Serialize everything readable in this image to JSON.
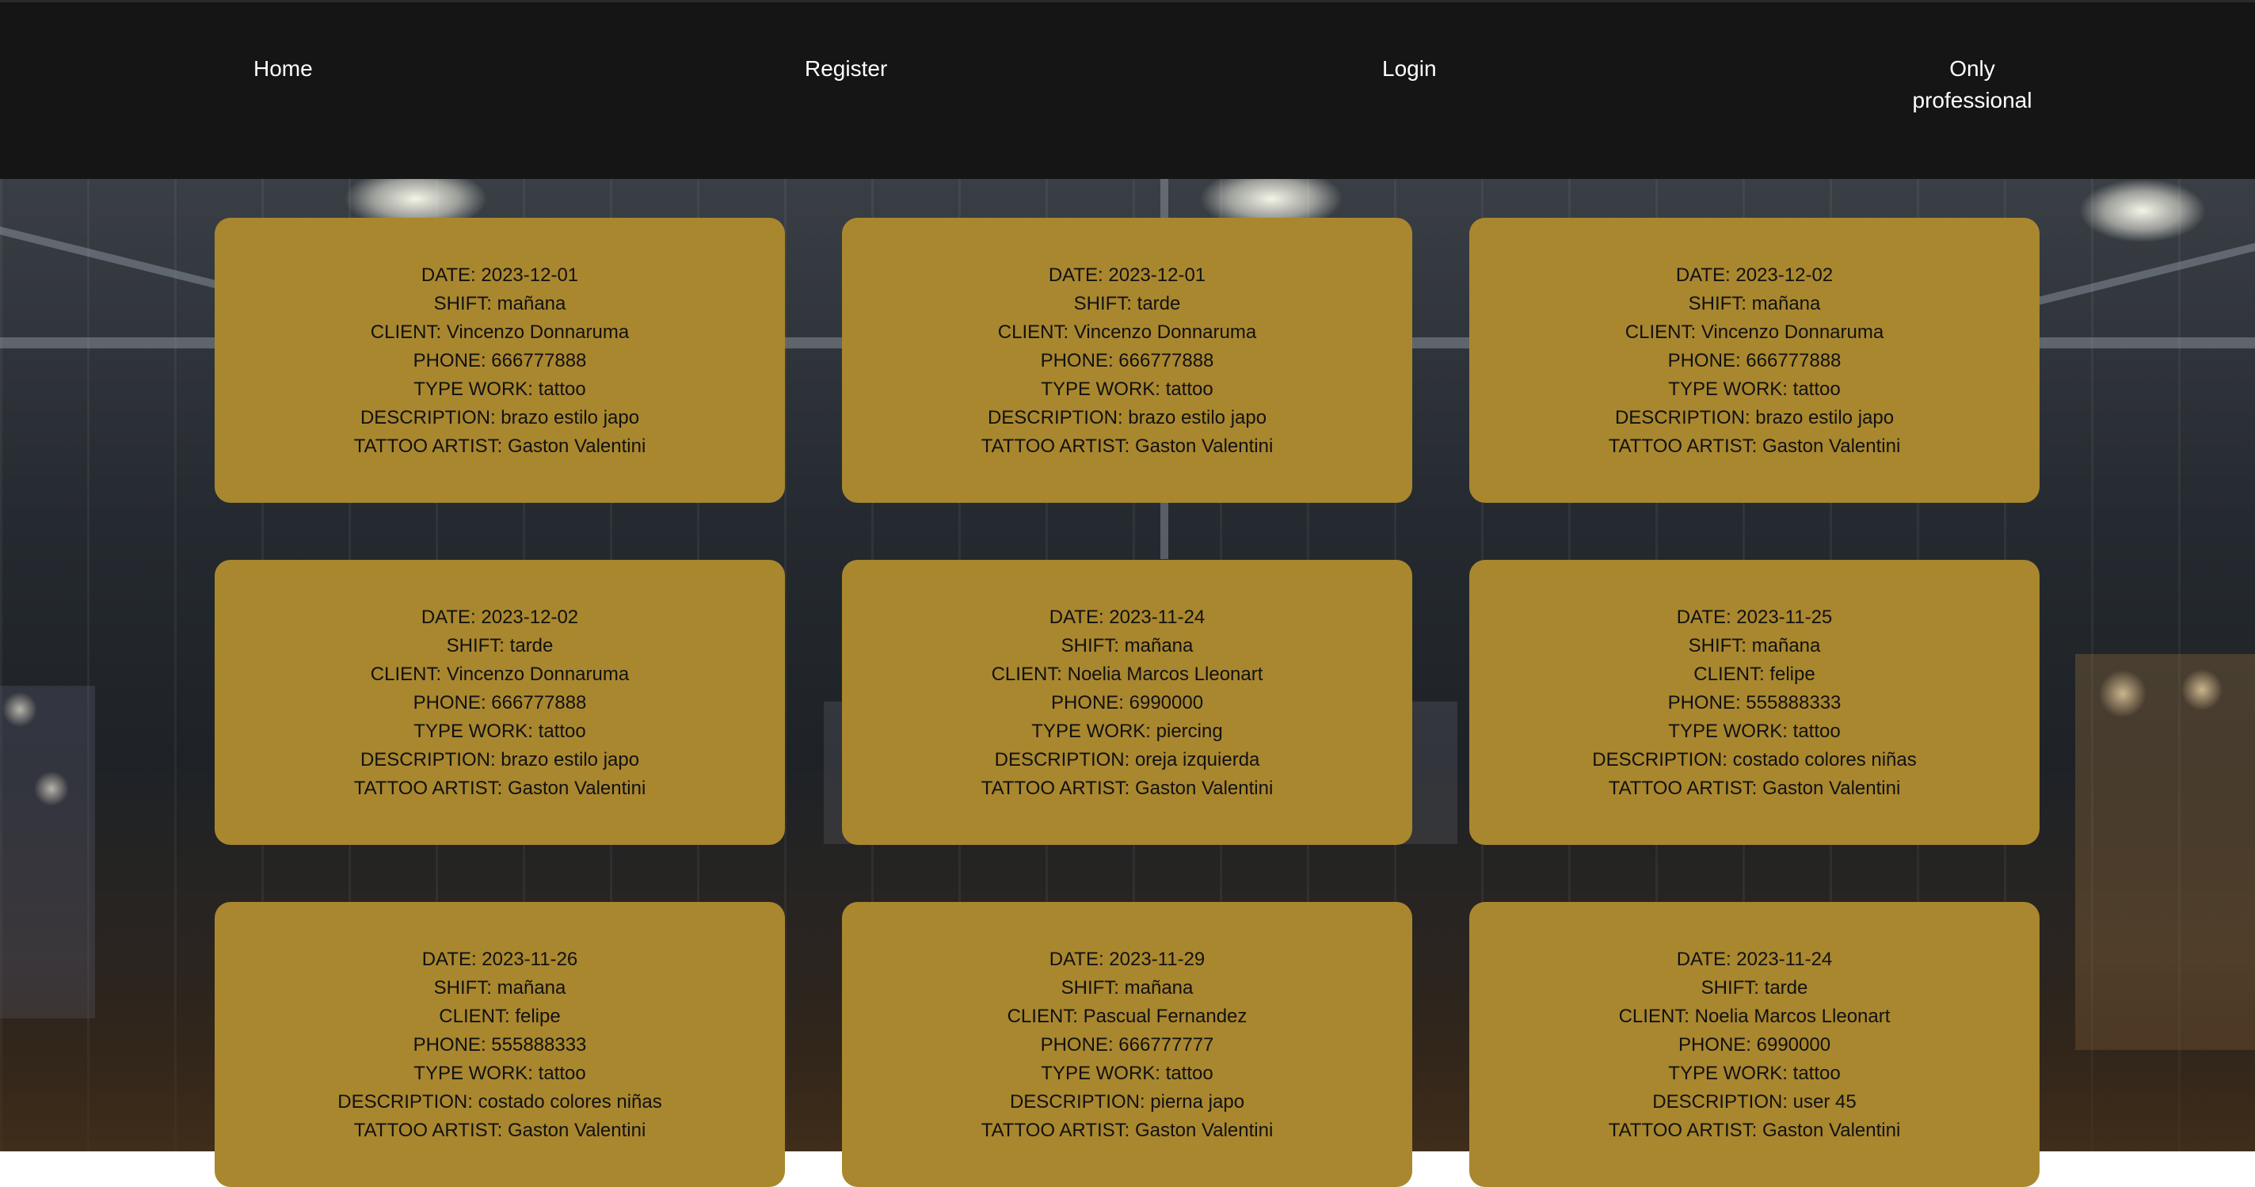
{
  "nav": {
    "home": "Home",
    "register": "Register",
    "login": "Login",
    "only_professional": "Only professional"
  },
  "appointments": [
    {
      "date": "DATE: 2023-12-01",
      "shift": "SHIFT: mañana",
      "client": "CLIENT: Vincenzo Donnaruma",
      "phone": "PHONE: 666777888",
      "type": "TYPE WORK: tattoo",
      "description": "DESCRIPTION: brazo estilo japo",
      "artist": "TATTOO ARTIST: Gaston Valentini"
    },
    {
      "date": "DATE: 2023-12-01",
      "shift": "SHIFT: tarde",
      "client": "CLIENT: Vincenzo Donnaruma",
      "phone": "PHONE: 666777888",
      "type": "TYPE WORK: tattoo",
      "description": "DESCRIPTION: brazo estilo japo",
      "artist": "TATTOO ARTIST: Gaston Valentini"
    },
    {
      "date": "DATE: 2023-12-02",
      "shift": "SHIFT: mañana",
      "client": "CLIENT: Vincenzo Donnaruma",
      "phone": "PHONE: 666777888",
      "type": "TYPE WORK: tattoo",
      "description": "DESCRIPTION: brazo estilo japo",
      "artist": "TATTOO ARTIST: Gaston Valentini"
    },
    {
      "date": "DATE: 2023-12-02",
      "shift": "SHIFT: tarde",
      "client": "CLIENT: Vincenzo Donnaruma",
      "phone": "PHONE: 666777888",
      "type": "TYPE WORK: tattoo",
      "description": "DESCRIPTION: brazo estilo japo",
      "artist": "TATTOO ARTIST: Gaston Valentini"
    },
    {
      "date": "DATE: 2023-11-24",
      "shift": "SHIFT: mañana",
      "client": "CLIENT: Noelia Marcos Lleonart",
      "phone": "PHONE: 6990000",
      "type": "TYPE WORK: piercing",
      "description": "DESCRIPTION: oreja izquierda",
      "artist": "TATTOO ARTIST: Gaston Valentini"
    },
    {
      "date": "DATE: 2023-11-25",
      "shift": "SHIFT: mañana",
      "client": "CLIENT: felipe",
      "phone": "PHONE: 555888333",
      "type": "TYPE WORK: tattoo",
      "description": "DESCRIPTION: costado colores niñas",
      "artist": "TATTOO ARTIST: Gaston Valentini"
    },
    {
      "date": "DATE: 2023-11-26",
      "shift": "SHIFT: mañana",
      "client": "CLIENT: felipe",
      "phone": "PHONE: 555888333",
      "type": "TYPE WORK: tattoo",
      "description": "DESCRIPTION: costado colores niñas",
      "artist": "TATTOO ARTIST: Gaston Valentini"
    },
    {
      "date": "DATE: 2023-11-29",
      "shift": "SHIFT: mañana",
      "client": "CLIENT: Pascual Fernandez",
      "phone": "PHONE: 666777777",
      "type": "TYPE WORK: tattoo",
      "description": "DESCRIPTION: pierna japo",
      "artist": "TATTOO ARTIST: Gaston Valentini"
    },
    {
      "date": "DATE: 2023-11-24",
      "shift": "SHIFT: tarde",
      "client": "CLIENT: Noelia Marcos Lleonart",
      "phone": "PHONE: 6990000",
      "type": "TYPE WORK: tattoo",
      "description": "DESCRIPTION: user 45",
      "artist": "TATTOO ARTIST: Gaston Valentini"
    }
  ],
  "colors": {
    "navbar_bg": "#151515",
    "card_bg": "#a9872f",
    "nav_text": "#ffffff",
    "card_text": "#111111"
  }
}
